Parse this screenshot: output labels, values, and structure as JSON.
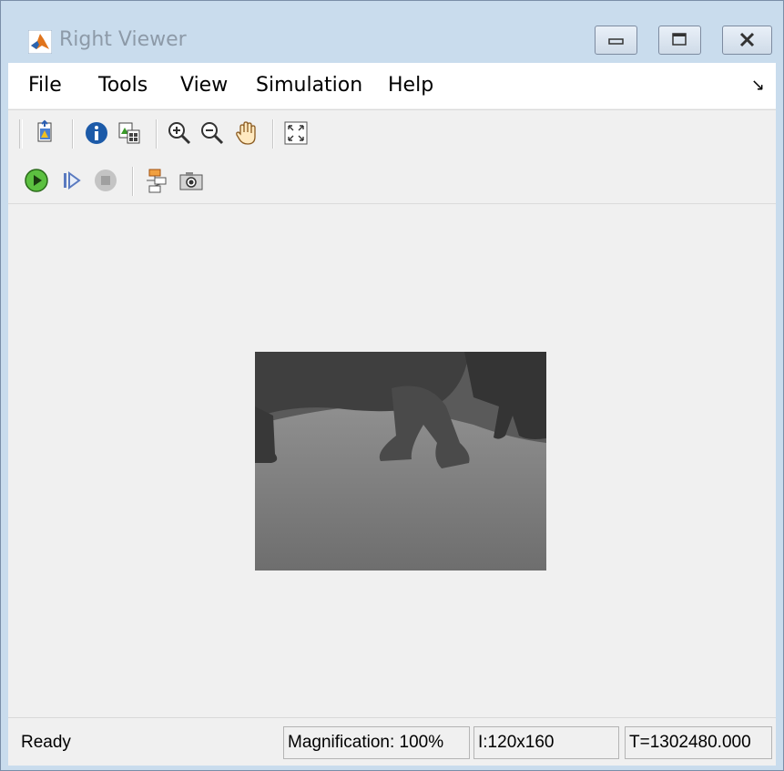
{
  "window": {
    "title": "Right Viewer",
    "icon": "matlab-icon",
    "controls": [
      "minimize-icon",
      "maximize-icon",
      "close-icon"
    ]
  },
  "menubar": {
    "items": [
      {
        "label": "File"
      },
      {
        "label": "Tools"
      },
      {
        "label": "View"
      },
      {
        "label": "Simulation"
      },
      {
        "label": "Help"
      }
    ],
    "overflow_icon": "dock-arrow-icon",
    "overflow_glyph": "↘"
  },
  "toolbar1": {
    "buttons": [
      "print-icon",
      "info-icon",
      "copy-to-clipboard-icon",
      "zoom-in-icon",
      "zoom-out-icon",
      "pan-hand-icon",
      "fit-to-window-icon"
    ]
  },
  "toolbar2": {
    "buttons": [
      "run-icon",
      "step-forward-icon",
      "stop-icon",
      "highlight-block-icon",
      "snapshot-camera-icon"
    ]
  },
  "display": {
    "content": "grayscale video frame"
  },
  "statusbar": {
    "status": "Ready",
    "magnification": "Magnification: 100%",
    "image_size": "I:120x160",
    "time": "T=1302480.000"
  },
  "colors": {
    "titlebar": "#c9dced",
    "client_bg": "#f0f0f0",
    "menubar_bg": "#ffffff",
    "run_green": "#3a9a2a",
    "info_blue": "#1c5aa8"
  }
}
